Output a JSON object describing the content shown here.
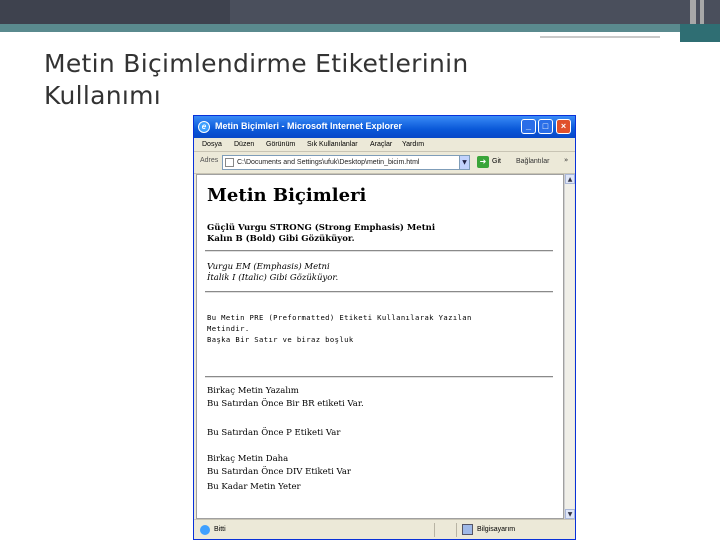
{
  "slide": {
    "title_line1": "Metin Biçimlendirme Etiketlerinin",
    "title_line2": "Kullanımı"
  },
  "browser": {
    "window_title": "Metin Biçimleri - Microsoft Internet Explorer",
    "menu": [
      "Dosya",
      "Düzen",
      "Görünüm",
      "Sık Kullanılanlar",
      "Araçlar",
      "Yardım"
    ],
    "address_label": "Adres",
    "address_value": "C:\\Documents and Settings\\ufuk\\Desktop\\metin_bicim.html",
    "go_label": "Git",
    "links_label": "Bağlantılar",
    "more": "»",
    "status_text": "Bitti",
    "zone_text": "Bilgisayarım"
  },
  "page": {
    "heading": "Metin Biçimleri",
    "strong_lines": [
      "Güçlü Vurgu STRONG (Strong Emphasis) Metni",
      "Kalın B (Bold) Gibi Gözüküyor."
    ],
    "em_lines": [
      "Vurgu EM (Emphasis) Metni",
      "İtalik I (Italic) Gibi Gözüküyor."
    ],
    "pre_lines": [
      "Bu Metin PRE (Preformatted) Etiketi Kullanılarak Yazılan",
      "Metindir.",
      "Başka Bir Satır ve biraz boşluk"
    ],
    "plain_lines": [
      "Birkaç Metin Yazalım",
      "Bu Satırdan Önce Bir BR etiketi Var.",
      "Bu Satırdan Önce P Etiketi Var",
      "Birkaç Metin Daha",
      "Bu Satırdan Önce DIV Etiketi Var",
      "Bu Kadar Metin Yeter"
    ]
  },
  "colors": {
    "title_bar": "#0a58d8",
    "slide_band": "#4a4f5c",
    "teal": "#5a8a8e"
  },
  "icons": [
    "internet-explorer-icon",
    "minimize-icon",
    "maximize-icon",
    "close-icon",
    "go-arrow-icon",
    "page-icon",
    "globe-icon",
    "computer-icon"
  ]
}
